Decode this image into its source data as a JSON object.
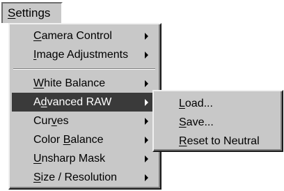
{
  "menubar": {
    "settings": {
      "pre": "",
      "key": "S",
      "post": "ettings"
    }
  },
  "settings_menu": {
    "items": [
      {
        "pre": "",
        "key": "C",
        "post": "amera Control",
        "submenu": true
      },
      {
        "pre": "",
        "key": "I",
        "post": "mage Adjustments",
        "submenu": true
      },
      {
        "pre": "",
        "key": "W",
        "post": "hite Balance",
        "submenu": true
      },
      {
        "pre": "A",
        "key": "d",
        "post": "vanced RAW",
        "submenu": true,
        "selected": true
      },
      {
        "pre": "Cur",
        "key": "v",
        "post": "es",
        "submenu": true
      },
      {
        "pre": "Color ",
        "key": "B",
        "post": "alance",
        "submenu": true
      },
      {
        "pre": "",
        "key": "U",
        "post": "nsharp Mask",
        "submenu": true
      },
      {
        "pre": "",
        "key": "S",
        "post": "ize / Resolution",
        "submenu": true
      }
    ]
  },
  "advanced_raw_submenu": {
    "items": [
      {
        "pre": "",
        "key": "L",
        "post": "oad..."
      },
      {
        "pre": "",
        "key": "S",
        "post": "ave..."
      },
      {
        "pre": "",
        "key": "R",
        "post": "eset to Neutral"
      }
    ]
  }
}
